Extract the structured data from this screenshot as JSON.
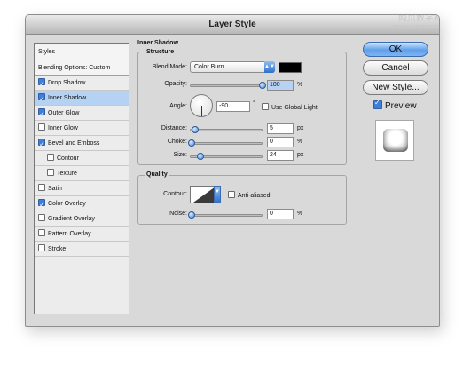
{
  "window": {
    "title": "Layer Style"
  },
  "watermark": {
    "line1": "网页教学网",
    "line2": "WWW.WEB3X.COM"
  },
  "styles_list": {
    "header": "Styles",
    "blending_options": "Blending Options: Custom",
    "items": [
      {
        "label": "Drop Shadow",
        "checked": true,
        "selected": false,
        "indent": false
      },
      {
        "label": "Inner Shadow",
        "checked": true,
        "selected": true,
        "indent": false
      },
      {
        "label": "Outer Glow",
        "checked": true,
        "selected": false,
        "indent": false
      },
      {
        "label": "Inner Glow",
        "checked": false,
        "selected": false,
        "indent": false
      },
      {
        "label": "Bevel and Emboss",
        "checked": true,
        "selected": false,
        "indent": false
      },
      {
        "label": "Contour",
        "checked": false,
        "selected": false,
        "indent": true
      },
      {
        "label": "Texture",
        "checked": false,
        "selected": false,
        "indent": true
      },
      {
        "label": "Satin",
        "checked": false,
        "selected": false,
        "indent": false
      },
      {
        "label": "Color Overlay",
        "checked": true,
        "selected": false,
        "indent": false
      },
      {
        "label": "Gradient Overlay",
        "checked": false,
        "selected": false,
        "indent": false
      },
      {
        "label": "Pattern Overlay",
        "checked": false,
        "selected": false,
        "indent": false
      },
      {
        "label": "Stroke",
        "checked": false,
        "selected": false,
        "indent": false
      }
    ]
  },
  "inner_shadow": {
    "section_title": "Inner Shadow",
    "structure": {
      "title": "Structure",
      "blend_mode_label": "Blend Mode:",
      "blend_mode_value": "Color Burn",
      "swatch_color": "#000000",
      "opacity_label": "Opacity:",
      "opacity_value": "100",
      "opacity_unit": "%",
      "opacity_level": 1.0,
      "angle_label": "Angle:",
      "angle_value": "-90",
      "angle_unit": "°",
      "use_global_light_label": "Use Global Light",
      "use_global_light_checked": false,
      "distance_label": "Distance:",
      "distance_value": "5",
      "distance_unit": "px",
      "choke_label": "Choke:",
      "choke_value": "0",
      "choke_unit": "%",
      "size_label": "Size:",
      "size_value": "24",
      "size_unit": "px"
    },
    "quality": {
      "title": "Quality",
      "contour_label": "Contour:",
      "anti_aliased_label": "Anti-aliased",
      "anti_aliased_checked": false,
      "noise_label": "Noise:",
      "noise_value": "0",
      "noise_unit": "%"
    }
  },
  "buttons": {
    "ok": "OK",
    "cancel": "Cancel",
    "new_style": "New Style...",
    "preview_label": "Preview",
    "preview_checked": true
  },
  "colors": {
    "accent": "#3f7fd9",
    "selected_row": "#b5d2f3",
    "dialog_bg": "#d9d9d9"
  }
}
